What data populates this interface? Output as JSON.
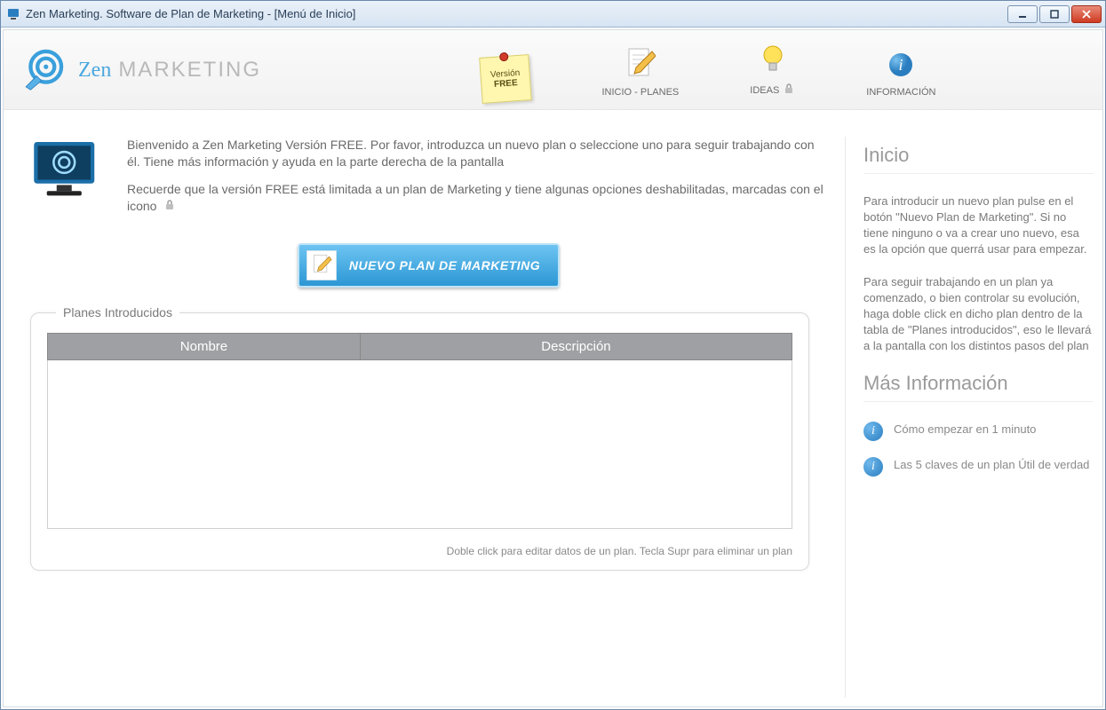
{
  "window": {
    "title": "Zen Marketing. Software de Plan de Marketing - [Menú de Inicio]"
  },
  "brand": {
    "zen": "Zen",
    "rest": "MARKETING"
  },
  "nav": {
    "free_note_line1": "Versión",
    "free_note_line2": "FREE",
    "inicio_planes": "INICIO - PLANES",
    "ideas": "IDEAS",
    "informacion": "INFORMACIÓN"
  },
  "intro": {
    "p1": "Bienvenido a Zen Marketing Versión FREE. Por favor, introduzca un nuevo plan o seleccione uno para seguir trabajando con él. Tiene más información y ayuda en la parte derecha de la pantalla",
    "p2": "Recuerde que la versión FREE está limitada a un plan de Marketing y tiene algunas opciones deshabilitadas, marcadas con el icono"
  },
  "new_plan_button": "NUEVO PLAN DE MARKETING",
  "plans_panel": {
    "legend": "Planes Introducidos",
    "col_name": "Nombre",
    "col_desc": "Descripción",
    "hint": "Doble click para editar datos de un plan. Tecla Supr para eliminar un plan"
  },
  "sidebar": {
    "h_inicio": "Inicio",
    "p_inicio1": "Para introducir un nuevo plan pulse en el botón \"Nuevo Plan de Marketing\". Si no tiene ninguno o va a crear uno nuevo, esa es la opción que querrá usar para empezar.",
    "p_inicio2": "Para seguir trabajando en un plan ya comenzado, o bien controlar su evolución, haga doble click en dicho plan dentro de la tabla de \"Planes introducidos\", eso le llevará a la pantalla con los distintos pasos del plan",
    "h_mas": "Más Información",
    "link1": "Cómo empezar en 1 minuto",
    "link2": "Las 5 claves de un plan Útil de verdad"
  }
}
